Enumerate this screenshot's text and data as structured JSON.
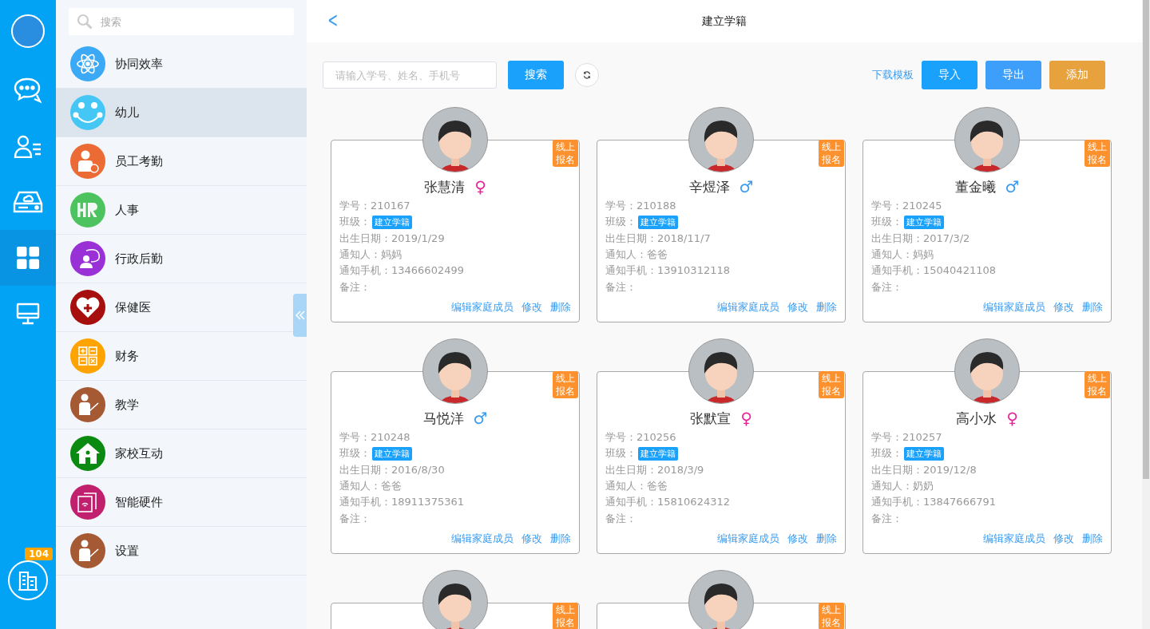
{
  "rail": {
    "items": [
      {
        "kind": "chat",
        "selected": false
      },
      {
        "kind": "contacts",
        "selected": false
      },
      {
        "kind": "drive",
        "selected": false
      },
      {
        "kind": "apps",
        "selected": true
      },
      {
        "kind": "monitor",
        "selected": false
      }
    ],
    "badge": "104"
  },
  "menu": {
    "search_placeholder": "搜索",
    "items": [
      {
        "label": "协同效率",
        "kind": "atom",
        "color": "#3ba9f5",
        "selected": false
      },
      {
        "label": "幼儿",
        "kind": "smile",
        "color": "#45c7f5",
        "selected": true
      },
      {
        "label": "员工考勤",
        "kind": "person",
        "color": "#ec6a33",
        "selected": false
      },
      {
        "label": "人事",
        "kind": "hr",
        "color": "#4cc35f",
        "selected": false
      },
      {
        "label": "行政后勤",
        "kind": "speaker",
        "color": "#9a31d6",
        "selected": false
      },
      {
        "label": "保健医",
        "kind": "heart",
        "color": "#a70e0e",
        "selected": false
      },
      {
        "label": "财务",
        "kind": "calc",
        "color": "#ffa300",
        "selected": false
      },
      {
        "label": "教学",
        "kind": "teacher",
        "color": "#a55a34",
        "selected": false
      },
      {
        "label": "家校互动",
        "kind": "house",
        "color": "#0b8a12",
        "selected": false
      },
      {
        "label": "智能硬件",
        "kind": "device",
        "color": "#c0206d",
        "selected": false
      },
      {
        "label": "设置",
        "kind": "teacher",
        "color": "#a55a34",
        "selected": false
      }
    ]
  },
  "header": {
    "back": "<",
    "title": "建立学籍"
  },
  "toolbar": {
    "search_placeholder": "请输入学号、姓名、手机号",
    "search_button": "搜索",
    "link": "下载模板",
    "buttons": [
      {
        "label": "导入",
        "kind": "primary"
      },
      {
        "label": "导出",
        "kind": "secondary"
      },
      {
        "label": "添加",
        "kind": "warning"
      }
    ]
  },
  "cards": [
    {
      "badge": "线上报名",
      "name": "张慧清",
      "gender": {
        "symbol": "♀",
        "color": "#e8249a"
      },
      "fields": [
        {
          "label": "学号：",
          "value": "210167"
        },
        {
          "label": "班级：",
          "tag": "建立学籍"
        },
        {
          "label": "出生日期：",
          "value": "2019/1/29"
        },
        {
          "label": "通知人：",
          "value": "妈妈"
        },
        {
          "label": "通知手机：",
          "value": "13466602499"
        },
        {
          "label": "备注："
        }
      ],
      "actions": [
        "编辑家庭成员",
        "修改",
        "删除"
      ]
    },
    {
      "badge": "线上报名",
      "name": "辛煜泽",
      "gender": {
        "symbol": "♂",
        "color": "#3a9bf0"
      },
      "fields": [
        {
          "label": "学号：",
          "value": "210188"
        },
        {
          "label": "班级：",
          "tag": "建立学籍"
        },
        {
          "label": "出生日期：",
          "value": "2018/11/7"
        },
        {
          "label": "通知人：",
          "value": "爸爸"
        },
        {
          "label": "通知手机：",
          "value": "13910312118"
        },
        {
          "label": "备注："
        }
      ],
      "actions": [
        "编辑家庭成员",
        "修改",
        "删除"
      ]
    },
    {
      "badge": "线上报名",
      "name": "董金曦",
      "gender": {
        "symbol": "♂",
        "color": "#3a9bf0"
      },
      "fields": [
        {
          "label": "学号：",
          "value": "210245"
        },
        {
          "label": "班级：",
          "tag": "建立学籍"
        },
        {
          "label": "出生日期：",
          "value": "2017/3/2"
        },
        {
          "label": "通知人：",
          "value": "妈妈"
        },
        {
          "label": "通知手机：",
          "value": "15040421108"
        },
        {
          "label": "备注："
        }
      ],
      "actions": [
        "编辑家庭成员",
        "修改",
        "删除"
      ]
    },
    {
      "badge": "线上报名",
      "name": "马悦洋",
      "gender": {
        "symbol": "♂",
        "color": "#3a9bf0"
      },
      "fields": [
        {
          "label": "学号：",
          "value": "210248"
        },
        {
          "label": "班级：",
          "tag": "建立学籍"
        },
        {
          "label": "出生日期：",
          "value": "2016/8/30"
        },
        {
          "label": "通知人：",
          "value": "爸爸"
        },
        {
          "label": "通知手机：",
          "value": "18911375361"
        },
        {
          "label": "备注："
        }
      ],
      "actions": [
        "编辑家庭成员",
        "修改",
        "删除"
      ]
    },
    {
      "badge": "线上报名",
      "name": "张默宣",
      "gender": {
        "symbol": "♀",
        "color": "#e8249a"
      },
      "fields": [
        {
          "label": "学号：",
          "value": "210256"
        },
        {
          "label": "班级：",
          "tag": "建立学籍"
        },
        {
          "label": "出生日期：",
          "value": "2018/3/9"
        },
        {
          "label": "通知人：",
          "value": "爸爸"
        },
        {
          "label": "通知手机：",
          "value": "15810624312"
        },
        {
          "label": "备注："
        }
      ],
      "actions": [
        "编辑家庭成员",
        "修改",
        "删除"
      ]
    },
    {
      "badge": "线上报名",
      "name": "高小水",
      "gender": {
        "symbol": "♀",
        "color": "#e8249a"
      },
      "fields": [
        {
          "label": "学号：",
          "value": "210257"
        },
        {
          "label": "班级：",
          "tag": "建立学籍"
        },
        {
          "label": "出生日期：",
          "value": "2019/12/8"
        },
        {
          "label": "通知人：",
          "value": "奶奶"
        },
        {
          "label": "通知手机：",
          "value": "13847666791"
        },
        {
          "label": "备注："
        }
      ],
      "actions": [
        "编辑家庭成员",
        "修改",
        "删除"
      ]
    },
    {
      "badge": "线上报名"
    },
    {
      "badge": "线上报名"
    }
  ]
}
